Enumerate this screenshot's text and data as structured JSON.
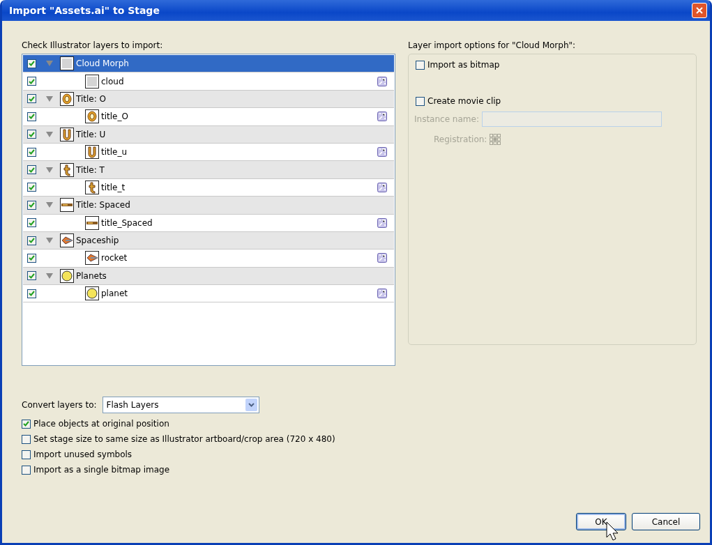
{
  "window": {
    "title": "Import \"Assets.ai\" to Stage"
  },
  "layers_label": "Check Illustrator layers to import:",
  "layers": [
    {
      "name": "Cloud Morph",
      "checked": true,
      "selected": true,
      "expanded": true,
      "children": [
        {
          "name": "cloud",
          "checked": true,
          "selected": false
        }
      ]
    },
    {
      "name": "Title: O",
      "checked": true,
      "selected": false,
      "expanded": true,
      "children": [
        {
          "name": "title_O",
          "checked": true,
          "selected": false
        }
      ]
    },
    {
      "name": "Title: U",
      "checked": true,
      "selected": false,
      "expanded": true,
      "children": [
        {
          "name": "title_u",
          "checked": true,
          "selected": false
        }
      ]
    },
    {
      "name": "Title: T",
      "checked": true,
      "selected": false,
      "expanded": true,
      "children": [
        {
          "name": "title_t",
          "checked": true,
          "selected": false
        }
      ]
    },
    {
      "name": "Title: Spaced",
      "checked": true,
      "selected": false,
      "expanded": true,
      "children": [
        {
          "name": "title_Spaced",
          "checked": true,
          "selected": false
        }
      ]
    },
    {
      "name": "Spaceship",
      "checked": true,
      "selected": false,
      "expanded": true,
      "children": [
        {
          "name": "rocket",
          "checked": true,
          "selected": false
        }
      ]
    },
    {
      "name": "Planets",
      "checked": true,
      "selected": false,
      "expanded": true,
      "children": [
        {
          "name": "planet",
          "checked": true,
          "selected": false
        }
      ]
    }
  ],
  "options": {
    "title": "Layer import options for \"Cloud Morph\":",
    "import_bitmap": {
      "label": "Import as bitmap",
      "checked": false
    },
    "movie_clip": {
      "label": "Create movie clip",
      "checked": false
    },
    "instance_name": {
      "label": "Instance name:",
      "disabled": true
    },
    "registration": {
      "label": "Registration:",
      "disabled": true
    }
  },
  "convert": {
    "label": "Convert layers to:",
    "value": "Flash Layers"
  },
  "checks": [
    {
      "label": "Place objects at original position",
      "checked": true
    },
    {
      "label": "Set stage size to same size as Illustrator artboard/crop area (720 x 480)",
      "checked": false
    },
    {
      "label": "Import unused symbols",
      "checked": false
    },
    {
      "label": "Import as a single bitmap image",
      "checked": false
    }
  ],
  "buttons": [
    {
      "label": "OK",
      "kind": "default"
    },
    {
      "label": "Cancel",
      "kind": "normal"
    }
  ]
}
